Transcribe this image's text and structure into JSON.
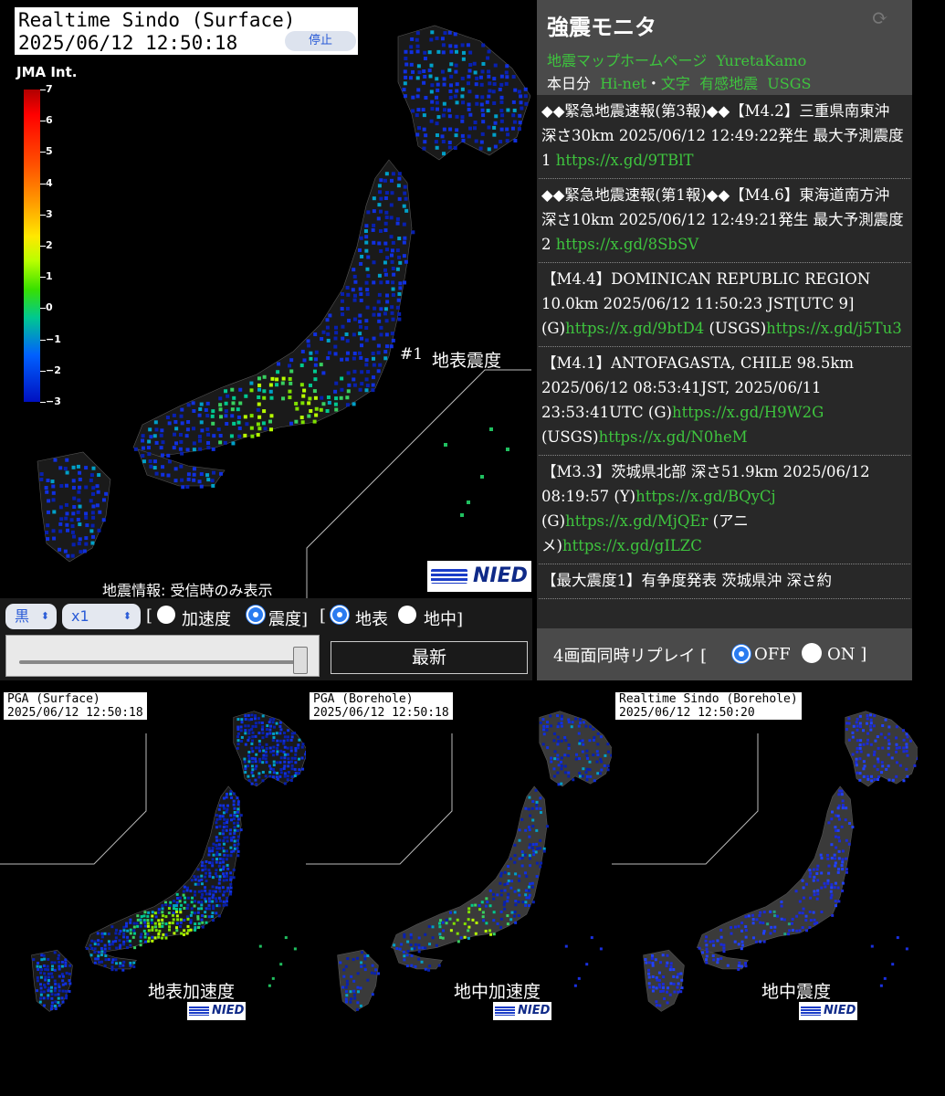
{
  "main": {
    "title": "Realtime Sindo (Surface)",
    "datetime": "2025/06/12 12:50:18",
    "stop_label": "停止",
    "scale_title": "JMA Int.",
    "scale_ticks": [
      "7",
      "6",
      "5",
      "4",
      "3",
      "2",
      "1",
      "0",
      "−1",
      "−2",
      "−3"
    ],
    "marker_number": "#1",
    "marker_label": "地表震度",
    "eq_info": "地震情報: 受信時のみ表示",
    "logo_text": "NIED"
  },
  "controls": {
    "color_select": "黒",
    "speed_select": "x1",
    "bracket_open": "[",
    "bracket_close": "]",
    "accel_label": "加速度",
    "sindo_label": "震度]",
    "bracket2_open": "[",
    "surface_label": "地表",
    "borehole_label": "地中]",
    "latest_label": "最新",
    "radio_states": {
      "accel": false,
      "sindo": true,
      "surface": true,
      "borehole": false
    }
  },
  "panel": {
    "title": "強震モニタ",
    "links_row1": [
      "地震マップホームページ",
      "YuretaKamo"
    ],
    "links_row2_prefix": "本日分",
    "links_row2": [
      "Hi-net",
      "・",
      "文字",
      "有感地震",
      "USGS"
    ],
    "news": [
      {
        "text": "◆◆緊急地震速報(第3報)◆◆【M4.2】三重県南東沖 深さ30km 2025/06/12 12:49:22発生 最大予測震度1 ",
        "links": [
          [
            "https://x.gd/9TBlT",
            ""
          ]
        ]
      },
      {
        "text": "◆◆緊急地震速報(第1報)◆◆【M4.6】東海道南方沖 深さ10km 2025/06/12 12:49:21発生 最大予測震度2 ",
        "links": [
          [
            "https://x.gd/8SbSV",
            ""
          ]
        ]
      },
      {
        "text": "【M4.4】DOMINICAN REPUBLIC REGION 10.0km 2025/06/12 11:50:23 JST[UTC 9] (G)",
        "links": [
          [
            "https://x.gd/9btD4",
            " (USGS)"
          ],
          [
            "https://x.gd/j5Tu3",
            ""
          ]
        ]
      },
      {
        "text": "【M4.1】ANTOFAGASTA, CHILE 98.5km 2025/06/12 08:53:41JST, 2025/06/11 23:53:41UTC (G)",
        "links": [
          [
            "https://x.gd/H9W2G",
            " (USGS)"
          ],
          [
            "https://x.gd/N0heM",
            ""
          ]
        ]
      },
      {
        "text": "【M3.3】茨城県北部 深さ51.9km 2025/06/12 08:19:57 (Y)",
        "links": [
          [
            "https://x.gd/BQyCj",
            " (G)"
          ],
          [
            "https://x.gd/MjQEr",
            " (アニメ)"
          ],
          [
            "https://x.gd/gILZC",
            ""
          ]
        ]
      },
      {
        "text": "【最大震度1】有争度発表 茨城県沖 深さ約",
        "links": []
      }
    ],
    "replay_label": "4画面同時リプレイ [",
    "replay_off": "OFF",
    "replay_on": "ON ]",
    "replay_state": "OFF"
  },
  "minis": [
    {
      "title": "PGA (Surface)",
      "datetime": "2025/06/12 12:50:18",
      "label": "地表加速度",
      "logo": "NIED"
    },
    {
      "title": "PGA (Borehole)",
      "datetime": "2025/06/12 12:50:18",
      "label": "地中加速度",
      "logo": "NIED"
    },
    {
      "title": "Realtime Sindo (Borehole)",
      "datetime": "2025/06/12 12:50:20",
      "label": "地中震度",
      "logo": "NIED"
    }
  ],
  "colors": {
    "link_green": "#3ec43e",
    "radio_blue": "#2a7bf0",
    "panel_dark": "#282828",
    "panel_header": "#4a4a4a"
  }
}
